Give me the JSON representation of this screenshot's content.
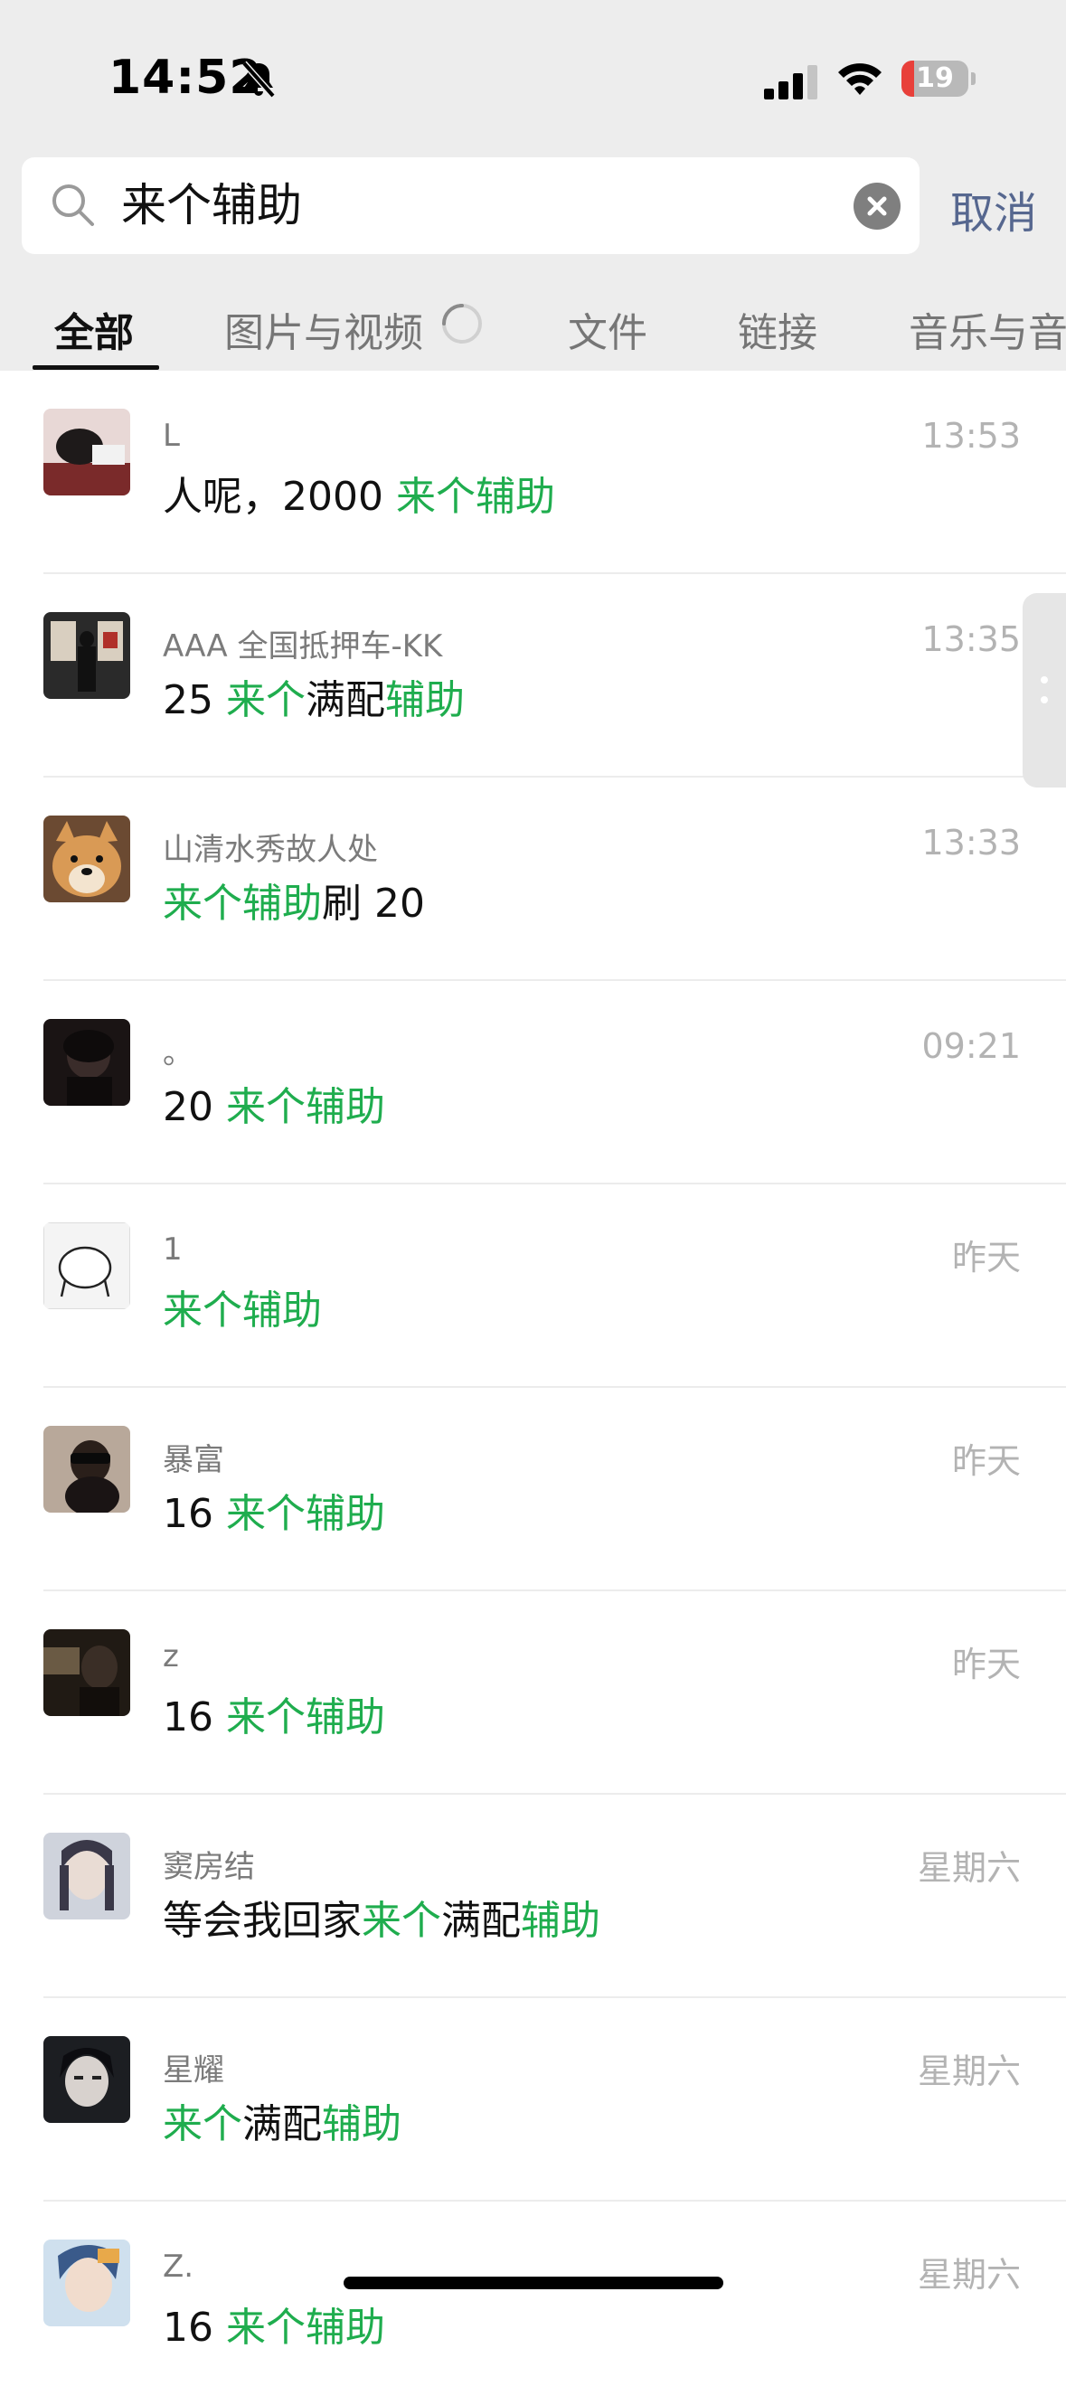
{
  "status_bar": {
    "time": "14:52",
    "battery_percent": "19",
    "battery_level": 0.19,
    "icons": [
      "bell-muted-icon",
      "cellular-signal-icon",
      "wifi-icon",
      "battery-icon"
    ]
  },
  "search": {
    "query": "来个辅助",
    "cancel_label": "取消",
    "icon": "search-icon"
  },
  "tabs": [
    {
      "label": "全部",
      "active": true
    },
    {
      "label": "图片与视频",
      "active": false,
      "loading": true
    },
    {
      "label": "文件",
      "active": false
    },
    {
      "label": "链接",
      "active": false
    },
    {
      "label": "音乐与音",
      "active": false
    }
  ],
  "colors": {
    "highlight": "#1fad4e",
    "cancel": "#56678f",
    "header_bg": "#ededed"
  },
  "results": [
    {
      "sender": "L",
      "time": "13:53",
      "message": [
        {
          "t": "人呢，2000 ",
          "h": false
        },
        {
          "t": "来个辅助",
          "h": true
        }
      ]
    },
    {
      "sender": "AAA 全国抵押车-KK",
      "time": "13:35",
      "message": [
        {
          "t": "25 ",
          "h": false
        },
        {
          "t": "来个",
          "h": true
        },
        {
          "t": "满配",
          "h": false
        },
        {
          "t": "辅助",
          "h": true
        }
      ]
    },
    {
      "sender": "山清水秀故人处",
      "time": "13:33",
      "message": [
        {
          "t": "来个辅助",
          "h": true
        },
        {
          "t": "刷 20",
          "h": false
        }
      ]
    },
    {
      "sender": "。",
      "time": "09:21",
      "message": [
        {
          "t": "20 ",
          "h": false
        },
        {
          "t": "来个辅助",
          "h": true
        }
      ]
    },
    {
      "sender": "1",
      "time": "昨天",
      "message": [
        {
          "t": "来个辅助",
          "h": true
        }
      ]
    },
    {
      "sender": "暴富",
      "time": "昨天",
      "message": [
        {
          "t": "16 ",
          "h": false
        },
        {
          "t": "来个辅助",
          "h": true
        }
      ]
    },
    {
      "sender": "z",
      "time": "昨天",
      "message": [
        {
          "t": "16 ",
          "h": false
        },
        {
          "t": "来个辅助",
          "h": true
        }
      ]
    },
    {
      "sender": "窦房结",
      "time": "星期六",
      "message": [
        {
          "t": "等会我回家",
          "h": false
        },
        {
          "t": "来个",
          "h": true
        },
        {
          "t": "满配",
          "h": false
        },
        {
          "t": "辅助",
          "h": true
        }
      ]
    },
    {
      "sender": "星耀",
      "time": "星期六",
      "message": [
        {
          "t": "来个",
          "h": true
        },
        {
          "t": "满配",
          "h": false
        },
        {
          "t": "辅助",
          "h": true
        }
      ]
    },
    {
      "sender": "Z.",
      "time": "星期六",
      "message": [
        {
          "t": "16 ",
          "h": false
        },
        {
          "t": "来个辅助",
          "h": true
        }
      ]
    }
  ]
}
